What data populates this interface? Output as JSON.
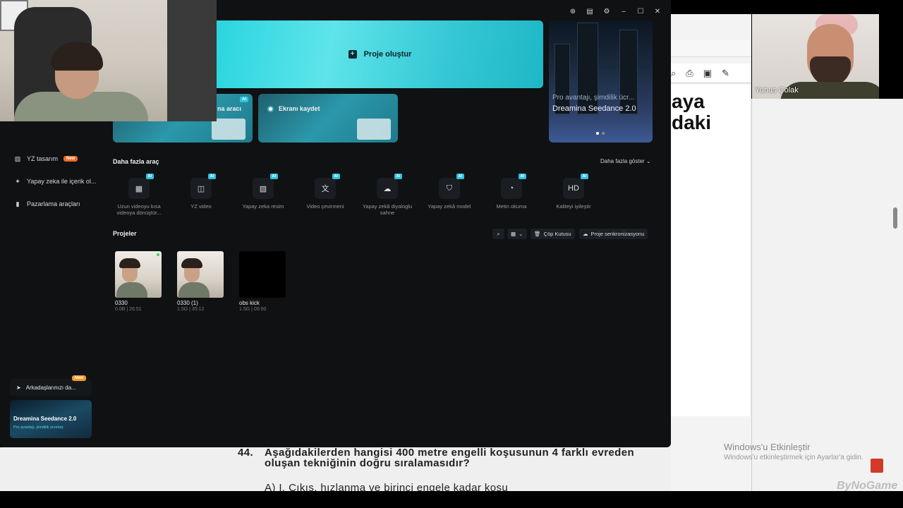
{
  "app": {
    "create_project": "Proje oluştur",
    "tool_card_1": "na aracı",
    "tool_card_2": "Ekranı kaydet",
    "ai_badge": "AI",
    "banner": {
      "line1": "Pro avantajı, şimdilik ücr...",
      "line2": "Dreamina Seedance 2.0"
    },
    "titlebar_icons": [
      "upload-icon",
      "feedback-icon",
      "settings-icon",
      "minimize-icon",
      "maximize-icon",
      "close-icon"
    ]
  },
  "sidebar": {
    "items": [
      {
        "label": "YZ tasarım",
        "badge": "New",
        "icon": "image-icon"
      },
      {
        "label": "Yapay zeka ile içerik ol...",
        "icon": "sparkle-icon"
      },
      {
        "label": "Pazarlama araçları",
        "icon": "bag-icon"
      }
    ],
    "invite": {
      "label": "Arkadaşlarınızı da...",
      "badge": "New"
    },
    "promo": {
      "title": "Dreamina Seedance 2.0",
      "subtitle": "Pro avantajı, şimdilik ücretsiz"
    }
  },
  "more_tools": {
    "title": "Daha fazla araç",
    "show_more": "Daha fazla göster",
    "items": [
      {
        "label": "Uzun videoyu kısa videoya dönüştür...",
        "icon": "film-icon"
      },
      {
        "label": "YZ video",
        "icon": "video-ai-icon"
      },
      {
        "label": "Yapay zeka resim",
        "icon": "image-ai-icon"
      },
      {
        "label": "Video çevirmeni",
        "icon": "translate-icon"
      },
      {
        "label": "Yapay zekâ diyaloglu sahne",
        "icon": "dialog-scene-icon"
      },
      {
        "label": "Yapay zekâ model",
        "icon": "model-icon"
      },
      {
        "label": "Metin okuma",
        "icon": "text-to-speech-icon"
      },
      {
        "label": "Kaliteyi iyileştir",
        "icon": "hd-icon"
      }
    ]
  },
  "projects": {
    "title": "Projeler",
    "trash": "Çöp Kutusu",
    "sync": "Proje senkronizasyonu",
    "items": [
      {
        "name": "0330",
        "meta": "0.0B | 26:51"
      },
      {
        "name": "0330 (1)",
        "meta": "1.5G | 35:12"
      },
      {
        "name": "obs kick",
        "meta": "1.5G | 00:00"
      }
    ]
  },
  "background": {
    "pdf_big_1": "aya",
    "pdf_big_2": "daki",
    "webcam_name": "Yunus Çolak",
    "question_number": "44.",
    "question_text": "Aşağıdakilerden hangisi 400 metre engelli koşusunun 4 farklı evreden oluşan tekniğinin doğru sıralamasıdır?",
    "question_option": "A) I.      Çıkış, hızlanma ve birinci engele kadar koşu",
    "windows_activate": "Windows'u Etkinleştir",
    "windows_activate_sub": "Windows'u etkinleştirmek için Ayarlar'a gidin.",
    "watermark": "ByNoGame"
  }
}
